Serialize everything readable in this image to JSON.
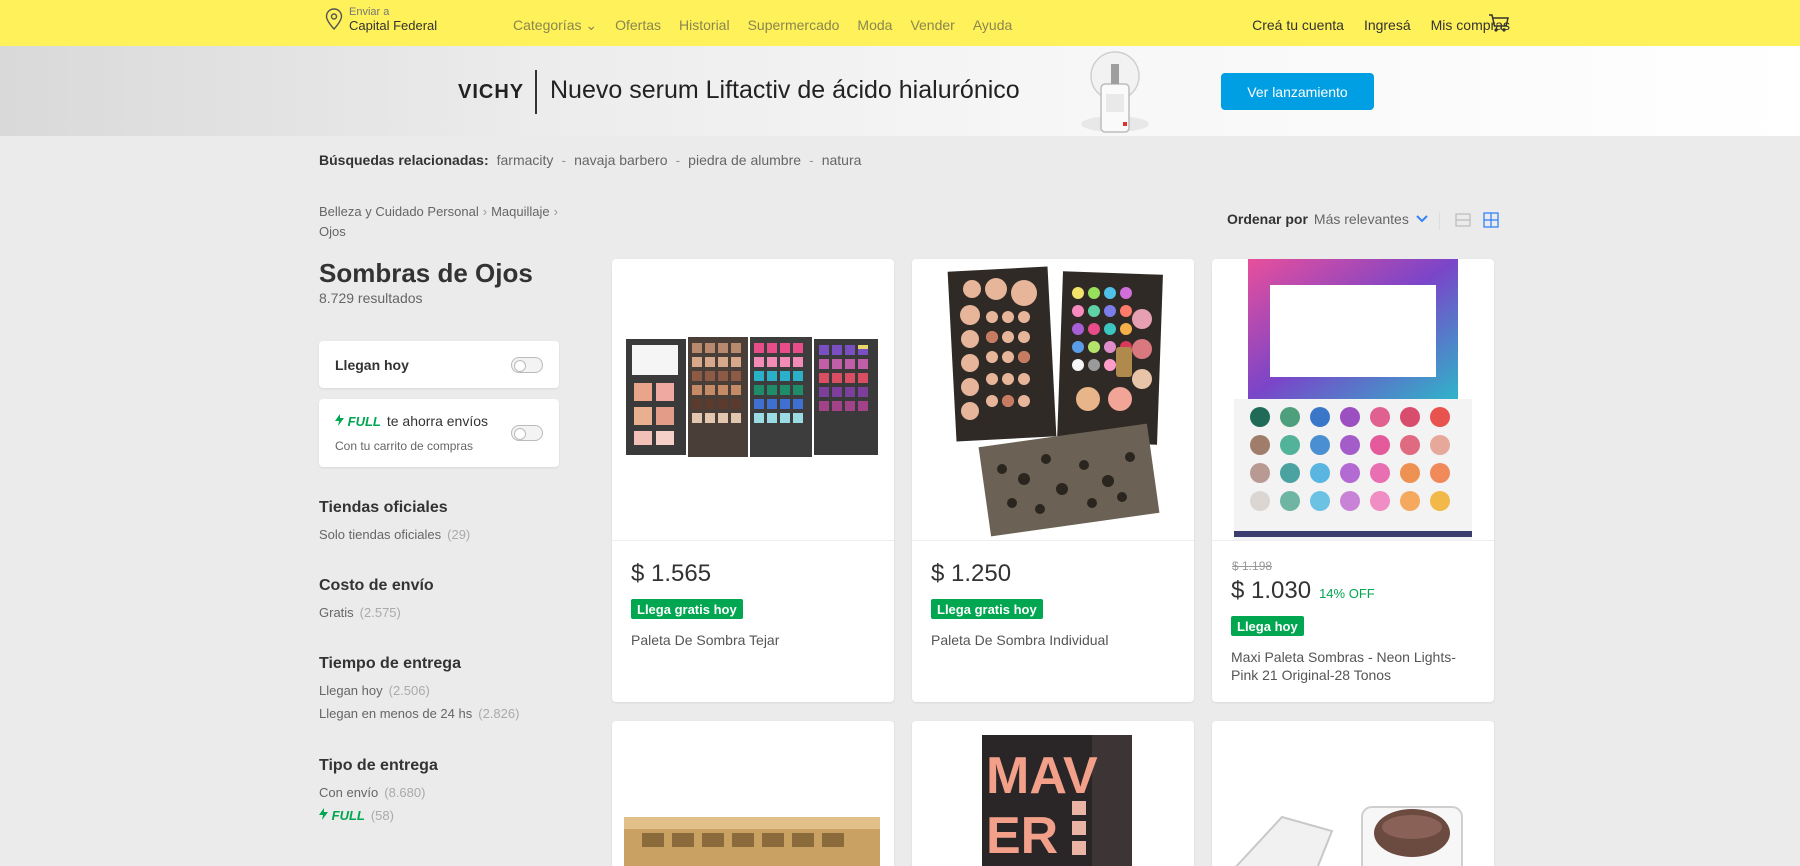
{
  "header": {
    "location_line1": "Enviar a",
    "location_line2": "Capital Federal",
    "nav": [
      "Categorías",
      "Ofertas",
      "Historial",
      "Supermercado",
      "Moda",
      "Vender",
      "Ayuda"
    ],
    "account": [
      "Creá tu cuenta",
      "Ingresá",
      "Mis compras"
    ]
  },
  "banner": {
    "brand": "VICHY",
    "headline": "Nuevo serum Liftactiv de ácido hialurónico",
    "button": "Ver lanzamiento",
    "button_color": "#009ee3"
  },
  "related": {
    "label": "Búsquedas relacionadas:",
    "links": [
      "farmacity",
      "navaja barbero",
      "piedra de alumbre",
      "natura"
    ]
  },
  "breadcrumb": {
    "items": [
      "Belleza y Cuidado Personal",
      "Maquillaje",
      "Ojos"
    ]
  },
  "sort": {
    "label": "Ordenar por",
    "value": "Más relevantes"
  },
  "page": {
    "title": "Sombras de Ojos",
    "results": "8.729 resultados"
  },
  "filters": {
    "llegan_hoy": "Llegan hoy",
    "full_badge": "FULL",
    "full_text": "te ahorra envíos",
    "full_sub": "Con tu carrito de compras",
    "sections": [
      {
        "title": "Tiendas oficiales",
        "items": [
          {
            "label": "Solo tiendas oficiales",
            "count": "(29)"
          }
        ]
      },
      {
        "title": "Costo de envío",
        "items": [
          {
            "label": "Gratis",
            "count": "(2.575)"
          }
        ]
      },
      {
        "title": "Tiempo de entrega",
        "items": [
          {
            "label": "Llegan hoy",
            "count": "(2.506)"
          },
          {
            "label": "Llegan en menos de 24 hs",
            "count": "(2.826)"
          }
        ]
      },
      {
        "title": "Tipo de entrega",
        "items": [
          {
            "label": "Con envío",
            "count": "(8.680)"
          },
          {
            "label": "FULL",
            "count": "(58)"
          }
        ]
      }
    ]
  },
  "products": [
    {
      "price": "$ 1.565",
      "badge": "Llega gratis hoy",
      "title": "Paleta De Sombra Tejar"
    },
    {
      "price": "$ 1.250",
      "badge": "Llega gratis hoy",
      "title": "Paleta De Sombra Individual"
    },
    {
      "old_price": "$ 1.198",
      "price": "$ 1.030",
      "discount": "14% OFF",
      "badge": "Llega hoy",
      "title": "Maxi Paleta Sombras - Neon Lights-Pink 21 Original-28 Tonos"
    }
  ],
  "colors": {
    "topbar": "#fff159",
    "free_shipping_green": "#00a650"
  },
  "icons": [
    "location-pin-icon",
    "chevron-down-icon",
    "cart-icon",
    "lightning-icon",
    "list-view-icon",
    "grid-view-icon"
  ]
}
